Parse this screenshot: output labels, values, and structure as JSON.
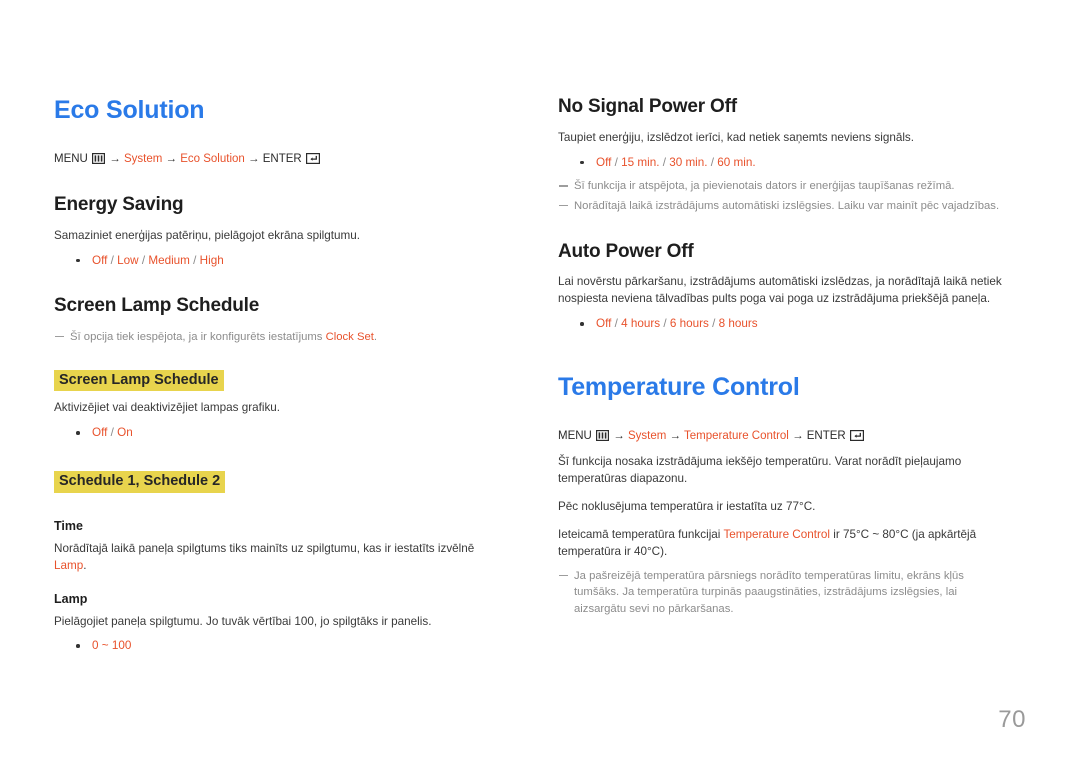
{
  "page": {
    "number": "70",
    "background": "#ffffff",
    "accent_blue": "#2a7ae8",
    "accent_orange": "#e8522c",
    "highlight_yellow": "#e8d44d"
  },
  "left_column": {
    "title": "Eco Solution",
    "menu_path": {
      "menu_label": "MENU",
      "menu_icon": "menu-bars-icon",
      "arrow1": "→",
      "item1": "System",
      "arrow2": "→",
      "item2": "Eco Solution",
      "arrow3": "→",
      "enter_label": "ENTER",
      "enter_icon": "enter-return-icon"
    },
    "energy_saving": {
      "heading": "Energy Saving",
      "description": "Samaziniet enerģijas patēriņu, pielāgojot ekrāna spilgtumu.",
      "options": [
        {
          "value": "Off",
          "sep": " / "
        },
        {
          "value": "Low",
          "sep": " / "
        },
        {
          "value": "Medium",
          "sep": " / "
        },
        {
          "value": "High",
          "sep": ""
        }
      ]
    },
    "screen_lamp_schedule": {
      "heading": "Screen Lamp Schedule",
      "note": "Šī opcija tiek iespējota, ja ir konfigurēts iestatījums ",
      "note_term": "Clock Set",
      "note_tail": ".",
      "sub1": {
        "heading": "Screen Lamp Schedule",
        "description": "Aktivizējiet vai deaktivizējiet lampas grafiku.",
        "options": [
          {
            "value": "Off",
            "sep": " / "
          },
          {
            "value": "On",
            "sep": ""
          }
        ]
      },
      "sub2": {
        "heading": "Schedule 1, Schedule 2",
        "time": {
          "heading": "Time",
          "description_pre": "Norādītajā laikā paneļa spilgtums tiks mainīts uz spilgtumu, kas ir iestatīts izvēlnē ",
          "description_term": "Lamp",
          "description_tail": "."
        },
        "lamp": {
          "heading": "Lamp",
          "description": "Pielāgojiet paneļa spilgtumu. Jo tuvāk vērtībai 100, jo spilgtāks ir panelis.",
          "options": [
            {
              "value": "0 ~ 100",
              "sep": ""
            }
          ]
        }
      }
    }
  },
  "right_column": {
    "no_signal_power_off": {
      "heading": "No Signal Power Off",
      "description": "Taupiet enerģiju, izslēdzot ierīci, kad netiek saņemts neviens signāls.",
      "options": [
        {
          "value": "Off",
          "sep": " / "
        },
        {
          "value": "15 min.",
          "sep": " / "
        },
        {
          "value": "30 min.",
          "sep": " / "
        },
        {
          "value": "60 min.",
          "sep": ""
        }
      ],
      "notes": [
        "Šī funkcija ir atspējota, ja pievienotais dators ir enerģijas taupīšanas režīmā.",
        "Norādītajā laikā izstrādājums automātiski izslēgsies. Laiku var mainīt pēc vajadzības."
      ]
    },
    "auto_power_off": {
      "heading": "Auto Power Off",
      "description": "Lai novērstu pārkaršanu, izstrādājums automātiski izslēdzas, ja norādītajā laikā netiek nospiesta neviena tālvadības pults poga vai poga uz izstrādājuma priekšējā paneļa.",
      "options": [
        {
          "value": "Off",
          "sep": " / "
        },
        {
          "value": "4 hours",
          "sep": " / "
        },
        {
          "value": "6 hours",
          "sep": " / "
        },
        {
          "value": "8 hours",
          "sep": ""
        }
      ]
    },
    "temperature_control": {
      "title": "Temperature Control",
      "menu_path": {
        "menu_label": "MENU",
        "menu_icon": "menu-bars-icon",
        "arrow1": "→",
        "item1": "System",
        "arrow2": "→",
        "item2": "Temperature Control",
        "arrow3": "→",
        "enter_label": "ENTER",
        "enter_icon": "enter-return-icon"
      },
      "para1": "Šī funkcija nosaka izstrādājuma iekšējo temperatūru. Varat norādīt pieļaujamo temperatūras diapazonu.",
      "para2": "Pēc noklusējuma temperatūra ir iestatīta uz 77°C.",
      "para3_pre": "Ieteicamā temperatūra funkcijai ",
      "para3_term": "Temperature Control",
      "para3_tail": " ir 75°C ~ 80°C (ja apkārtējā temperatūra ir 40°C).",
      "note": "Ja pašreizējā temperatūra pārsniegs norādīto temperatūras limitu, ekrāns kļūs tumšāks. Ja temperatūra turpinās paaugstināties, izstrādājums izslēgsies, lai aizsargātu sevi no pārkaršanas."
    }
  }
}
